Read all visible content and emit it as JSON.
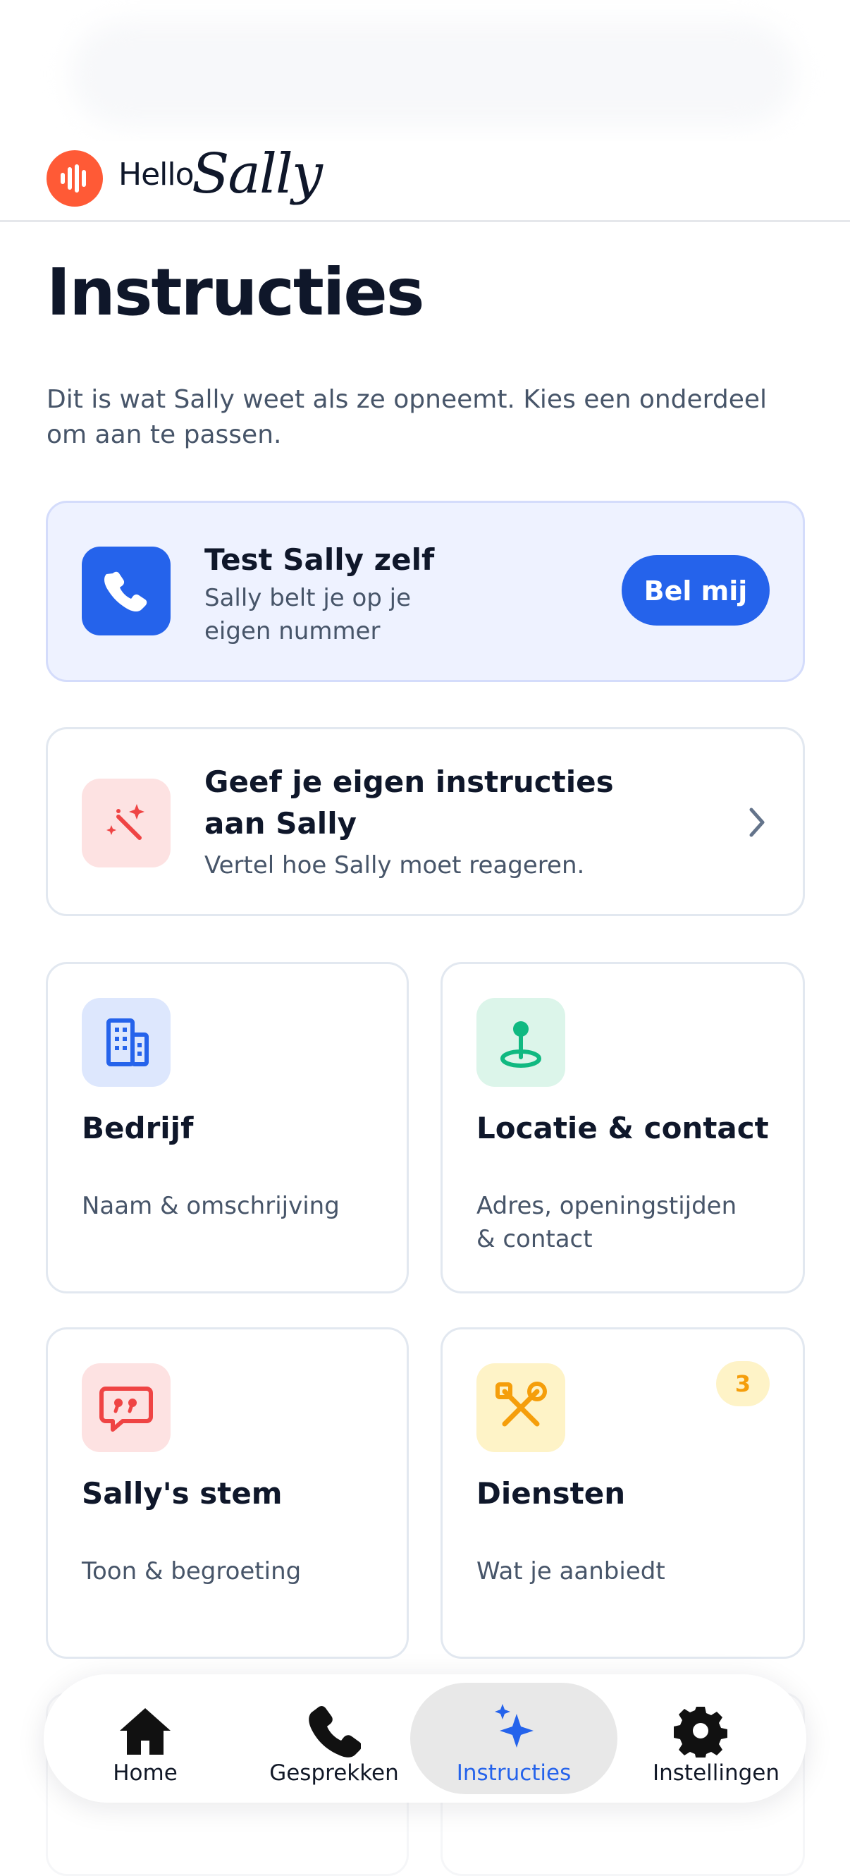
{
  "app": {
    "logo_hello": "Hello",
    "logo_sally": "Sally"
  },
  "page": {
    "title": "Instructies",
    "intro": "Dit is wat Sally weet als ze opneemt. Kies een onderdeel om aan te passen."
  },
  "test_card": {
    "title": "Test Sally zelf",
    "subtitle_line1": "Sally belt je op je",
    "subtitle_line2": "eigen nummer",
    "button": "Bel mij",
    "icon": "phone-icon"
  },
  "custom_card": {
    "title_line1": "Geef je eigen instructies",
    "title_line2": "aan Sally",
    "subtitle": "Vertel hoe Sally moet reageren.",
    "icon": "magic-wand-icon"
  },
  "sections": [
    {
      "title": "Bedrijf",
      "sub_line1": "Naam & omschrijving",
      "sub_line2": "",
      "icon": "building-icon",
      "accent": "#2563eb"
    },
    {
      "title": "Locatie & contact",
      "sub_line1": "Adres, openingstijden",
      "sub_line2": "& contact",
      "icon": "location-pin-icon",
      "accent": "#10b981"
    },
    {
      "title": "Sally's stem",
      "sub_line1": "Toon & begroeting",
      "sub_line2": "",
      "icon": "quote-bubble-icon",
      "accent": "#ef4444"
    },
    {
      "title": "Diensten",
      "sub_line1": "Wat je aanbiedt",
      "sub_line2": "",
      "icon": "tools-icon",
      "accent": "#f59e0b",
      "badge": "3"
    }
  ],
  "tabbar": {
    "tabs": [
      {
        "label": "Home",
        "icon": "home-icon",
        "active": false
      },
      {
        "label": "Gesprekken",
        "icon": "phone-icon",
        "active": false
      },
      {
        "label": "Instructies",
        "icon": "sparkles-icon",
        "active": true
      },
      {
        "label": "Instellingen",
        "icon": "gear-icon",
        "active": false
      }
    ]
  },
  "colors": {
    "brand": "#ff5a36",
    "accent": "#2563eb",
    "text": "#0f172a",
    "muted": "#475569"
  }
}
